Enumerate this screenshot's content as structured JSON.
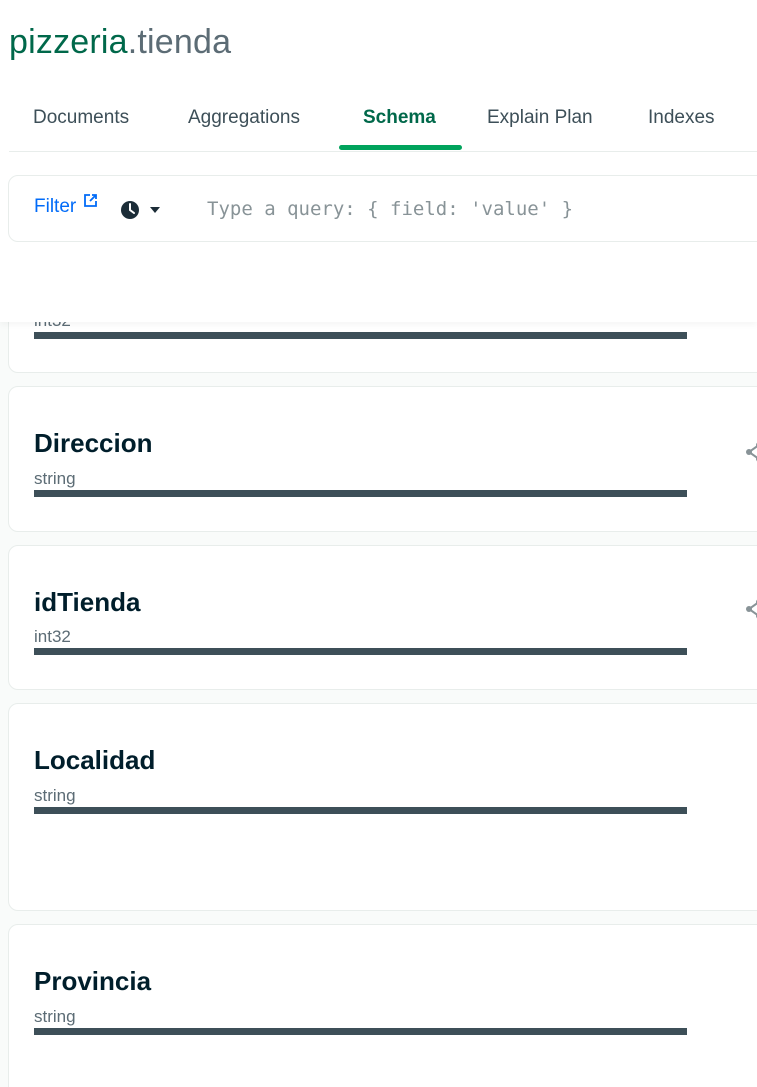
{
  "header": {
    "db_name": "pizzeria",
    "coll_name": ".tienda"
  },
  "tabs": [
    {
      "label": "Documents"
    },
    {
      "label": "Aggregations"
    },
    {
      "label": "Schema"
    },
    {
      "label": "Explain Plan"
    },
    {
      "label": "Indexes"
    }
  ],
  "active_tab": "Schema",
  "query_bar": {
    "filter_label": "Filter",
    "placeholder": "Type a query: { field: 'value' }"
  },
  "fields": [
    {
      "name": "",
      "type": "int32"
    },
    {
      "name": "Direccion",
      "type": "string"
    },
    {
      "name": "idTienda",
      "type": "int32"
    },
    {
      "name": "Localidad",
      "type": "string"
    },
    {
      "name": "Provincia",
      "type": "string"
    }
  ],
  "colors": {
    "brand_green": "#00684a",
    "tab_underline": "#00a35c",
    "link_blue": "#016bf8",
    "bar": "#3d4f58"
  }
}
